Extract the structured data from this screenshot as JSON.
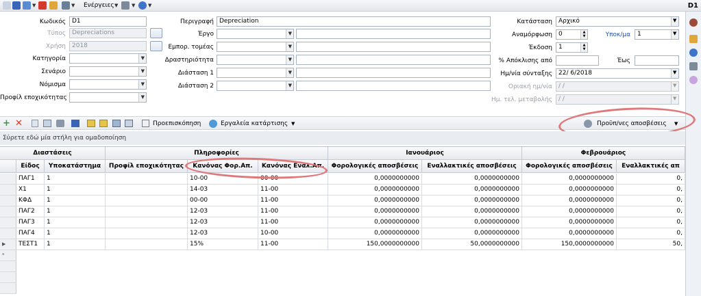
{
  "toolbar": {
    "actions_label": "Ενέργειες",
    "doc_id": "D1"
  },
  "form": {
    "code_label": "Κωδικός",
    "code_value": "D1",
    "type_label": "Τύπος",
    "type_value": "Depreciations",
    "year_label": "Χρήση",
    "year_value": "2018",
    "category_label": "Κατηγορία",
    "scenario_label": "Σενάριο",
    "currency_label": "Νόμισμα",
    "taxprofile_label": "Προφίλ εποχικότητας",
    "description_label": "Περιγραφή",
    "description_value": "Depreciation",
    "project_label": "Έργο",
    "commercial_label": "Εμπορ. τομέας",
    "activity_label": "Δραστηριότητα",
    "dimension1_label": "Διάσταση 1",
    "dimension2_label": "Διάσταση 2",
    "status_label": "Κατάσταση",
    "status_value": "Αρχικό",
    "rounding_label": "Αναμόρφωση",
    "rounding_value": "0",
    "submod_label": "Υποκ/μα",
    "submod_value": "1",
    "version_label": "Έκδοση",
    "version_value": "1",
    "deviation_label": "% Απόκλισης από",
    "to_label": "Έως",
    "compile_date_label": "Ημ/νία σύνταξης",
    "compile_date_value": "22/ 6/2018",
    "final_date_label": "Οριακή ημ/νία",
    "final_date_value": "  /  /",
    "last_change_label": "Ημ. τελ. μεταβολής",
    "last_change_value": "  /  /"
  },
  "gridbar": {
    "preview_label": "Προεπισκόπηση",
    "tools_label": "Εργαλεία κατάρτισης",
    "calc_label": "Προϋπ/νες αποσβέσεις"
  },
  "groupbar_text": "Σύρετε εδώ μία στήλη για ομαδοποίηση",
  "grid": {
    "group_headers": [
      "Διαστάσεις",
      "Πληροφορίες",
      "Ιανουάριος",
      "Φεβρουάριος"
    ],
    "columns": [
      "Είδος",
      "Υποκατάστημα",
      "Προφίλ εποχικότητας",
      "Κανόνας Φορ.Απ.",
      "Κανόνας Εναλ.Απ.",
      "Φορολογικές αποσβέσεις",
      "Εναλλακτικές αποσβέσεις",
      "Φορολογικές αποσβέσεις",
      "Εναλλακτικές απ"
    ],
    "rows": [
      [
        "ΠΑΓ1",
        "1",
        "",
        "10-00",
        "00-00",
        "0,0000000000",
        "0,0000000000",
        "0,0000000000",
        "0,"
      ],
      [
        "Χ1",
        "1",
        "",
        "14-03",
        "11-00",
        "0,0000000000",
        "0,0000000000",
        "0,0000000000",
        "0,"
      ],
      [
        "ΚΦΔ",
        "1",
        "",
        "00-00",
        "11-00",
        "0,0000000000",
        "0,0000000000",
        "0,0000000000",
        "0,"
      ],
      [
        "ΠΑΓ2",
        "1",
        "",
        "12-03",
        "11-00",
        "0,0000000000",
        "0,0000000000",
        "0,0000000000",
        "0,"
      ],
      [
        "ΠΑΓ3",
        "1",
        "",
        "12-03",
        "11-00",
        "0,0000000000",
        "0,0000000000",
        "0,0000000000",
        "0,"
      ],
      [
        "ΠΑΓ4",
        "1",
        "",
        "12-03",
        "10-00",
        "0,0000000000",
        "0,0000000000",
        "0,0000000000",
        "0,"
      ],
      [
        "ΤΕΣΤ1",
        "1",
        "",
        "15%",
        "11-00",
        "150,0000000000",
        "50,0000000000",
        "150,0000000000",
        "50,"
      ]
    ]
  }
}
